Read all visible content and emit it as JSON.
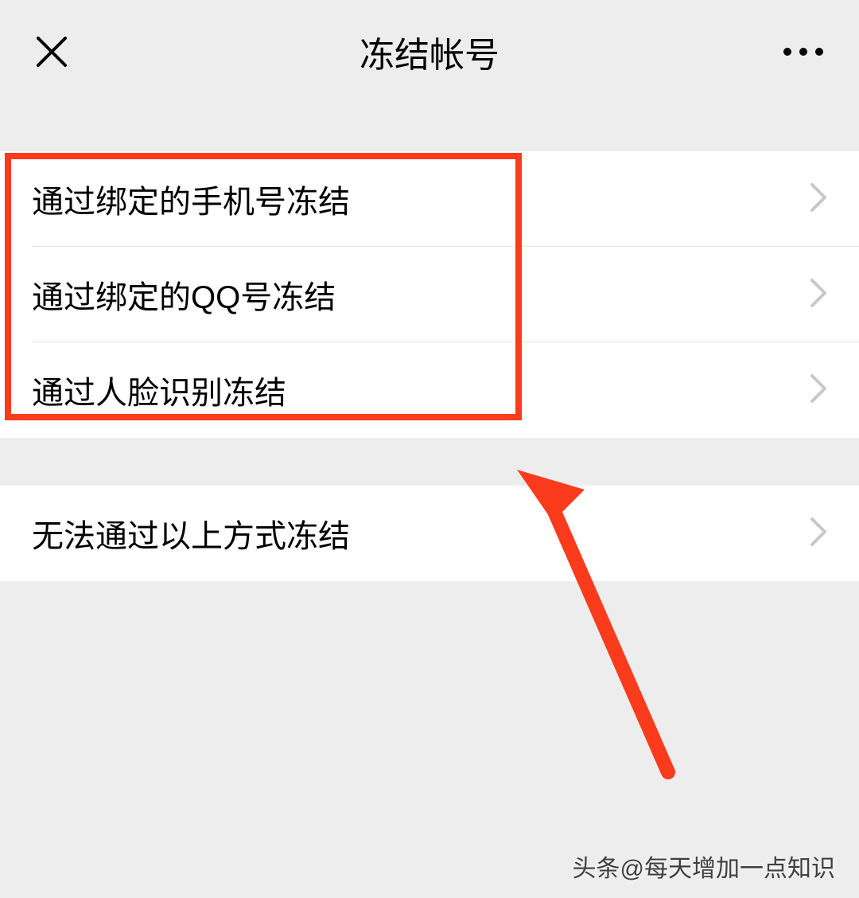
{
  "header": {
    "title": "冻结帐号"
  },
  "group1": {
    "items": [
      {
        "label": "通过绑定的手机号冻结"
      },
      {
        "label": "通过绑定的QQ号冻结"
      },
      {
        "label": "通过人脸识别冻结"
      }
    ]
  },
  "group2": {
    "items": [
      {
        "label": "无法通过以上方式冻结"
      }
    ]
  },
  "watermark": "头条@每天增加一点知识",
  "annotation": {
    "highlight_color": "#fc3b1c",
    "arrow_color": "#fc3b1c"
  }
}
